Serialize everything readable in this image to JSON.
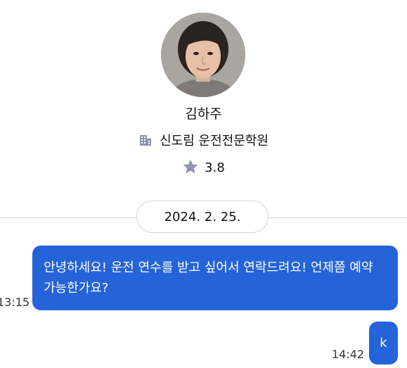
{
  "profile": {
    "name": "김하주",
    "organization": "신도림 운전전문학원",
    "rating": "3.8"
  },
  "chat": {
    "date": "2024. 2. 25.",
    "messages": [
      {
        "text": "안녕하세요! 운전 연수를 받고 싶어서 연락드려요! 언제쯤 예약 가능한가요?",
        "time": "13:15"
      },
      {
        "text": "k",
        "time": "14:42"
      }
    ]
  },
  "colors": {
    "bubble": "#2563d9",
    "icon": "#8e95ad"
  },
  "icons": {
    "org": "building-icon",
    "rating": "star-icon"
  }
}
